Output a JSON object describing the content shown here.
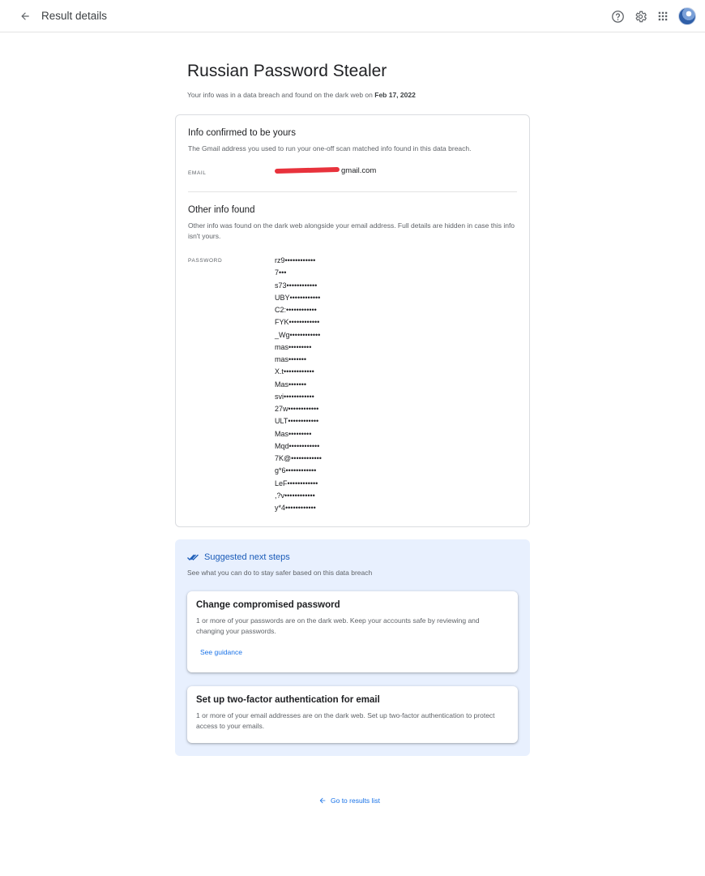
{
  "topbar": {
    "title": "Result details",
    "icons": [
      "back-arrow-icon",
      "help-icon",
      "gear-icon",
      "apps-grid-icon",
      "avatar"
    ]
  },
  "header": {
    "title": "Russian Password Stealer",
    "subtitle_prefix": "Your info was in a data breach and found on the dark web on ",
    "subtitle_date": "Feb 17, 2022"
  },
  "confirmed": {
    "title": "Info confirmed to be yours",
    "description": "The Gmail address you used to run your one-off scan matched info found in this data breach.",
    "email_label": "EMAIL",
    "email_suffix": "gmail.com"
  },
  "other": {
    "title": "Other info found",
    "description": "Other info was found on the dark web alongside your email address. Full details are hidden in case this info isn't yours.",
    "password_label": "PASSWORD",
    "passwords": [
      "rz9••••••••••••",
      "7•••",
      "s73••••••••••••",
      "UBY••••••••••••",
      "C2:••••••••••••",
      "FYK••••••••••••",
      "_Wg••••••••••••",
      "mas•••••••••",
      "mas•••••••",
      "X.t••••••••••••",
      "Mas•••••••",
      "svi••••••••••••",
      "27w••••••••••••",
      "ULT••••••••••••",
      "Mas•••••••••",
      "Mqd••••••••••••",
      "7K@••••••••••••",
      "g*6••••••••••••",
      "LeF••••••••••••",
      ",?v••••••••••••",
      "y*4••••••••••••"
    ]
  },
  "next_steps": {
    "title": "Suggested next steps",
    "description": "See what you can do to stay safer based on this data breach",
    "cards": [
      {
        "title": "Change compromised password",
        "description": "1 or more of your passwords are on the dark web. Keep your accounts safe by reviewing and changing your passwords.",
        "link": "See guidance"
      },
      {
        "title": "Set up two-factor authentication for email",
        "description": "1 or more of your email addresses are on the dark web. Set up two-factor authentication to protect access to your emails."
      }
    ]
  },
  "footer": {
    "results_link": "Go to results list"
  },
  "colors": {
    "accent": "#1a73e8",
    "panel_bg": "#e8f0fe",
    "redaction": "#e8323c"
  }
}
